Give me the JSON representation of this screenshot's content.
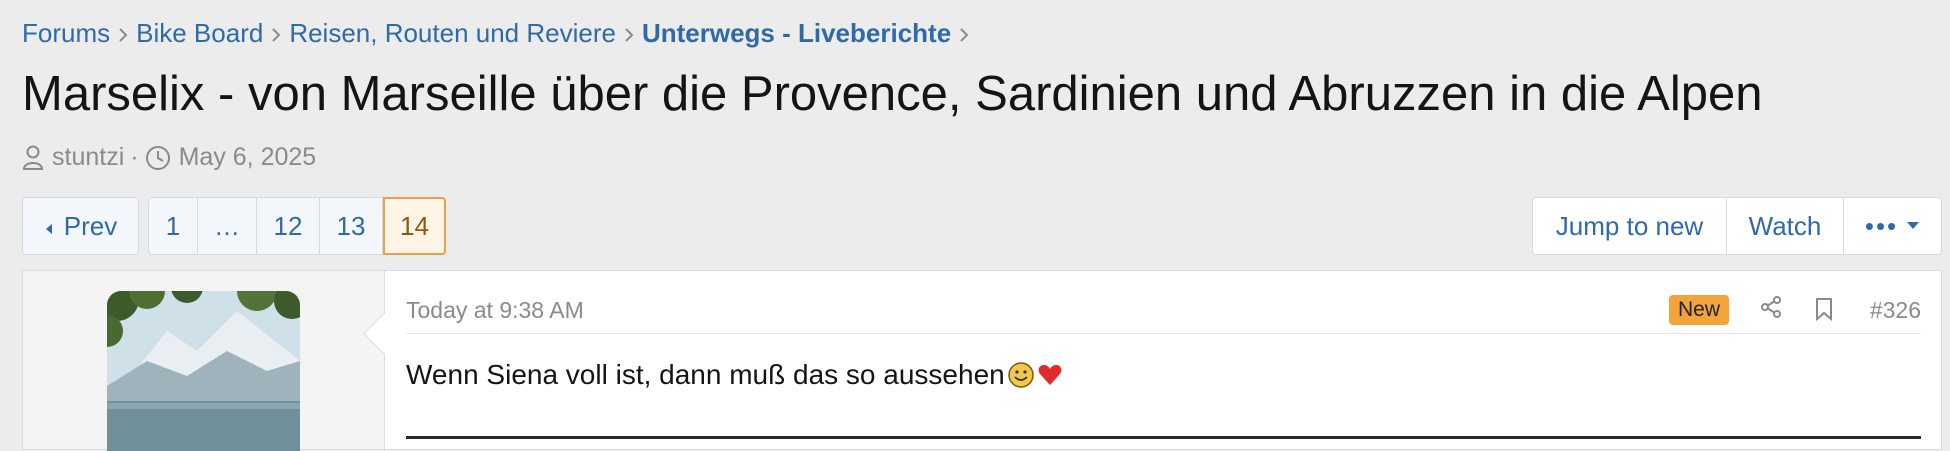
{
  "breadcrumb": {
    "items": [
      "Forums",
      "Bike Board",
      "Reisen, Routen und Reviere",
      "Unterwegs - Liveberichte"
    ]
  },
  "thread": {
    "title": "Marselix - von Marseille über die Provence, Sardinien und Abruzzen in die Alpen",
    "author": "stuntzi",
    "separator": "·",
    "date": "May 6, 2025"
  },
  "pagination": {
    "prev_label": "Prev",
    "pages": [
      "1",
      "…",
      "12",
      "13",
      "14"
    ],
    "current": "14"
  },
  "actions": {
    "jump_label": "Jump to new",
    "watch_label": "Watch",
    "more_label": "•••"
  },
  "post": {
    "time": "Today at 9:38 AM",
    "badge": "New",
    "number": "#326",
    "text": "Wenn Siena voll ist, dann muß das so aussehen"
  },
  "colors": {
    "link": "#2f6aa8",
    "current_page_border": "#e6a14a",
    "new_badge": "#f2a33a",
    "background": "#ececec"
  },
  "icons": [
    "chevron-right-icon",
    "user-icon",
    "clock-icon",
    "triangle-left-icon",
    "caret-down-icon",
    "share-icon",
    "bookmark-icon",
    "smile-emoji-icon",
    "heart-emoji-icon"
  ]
}
